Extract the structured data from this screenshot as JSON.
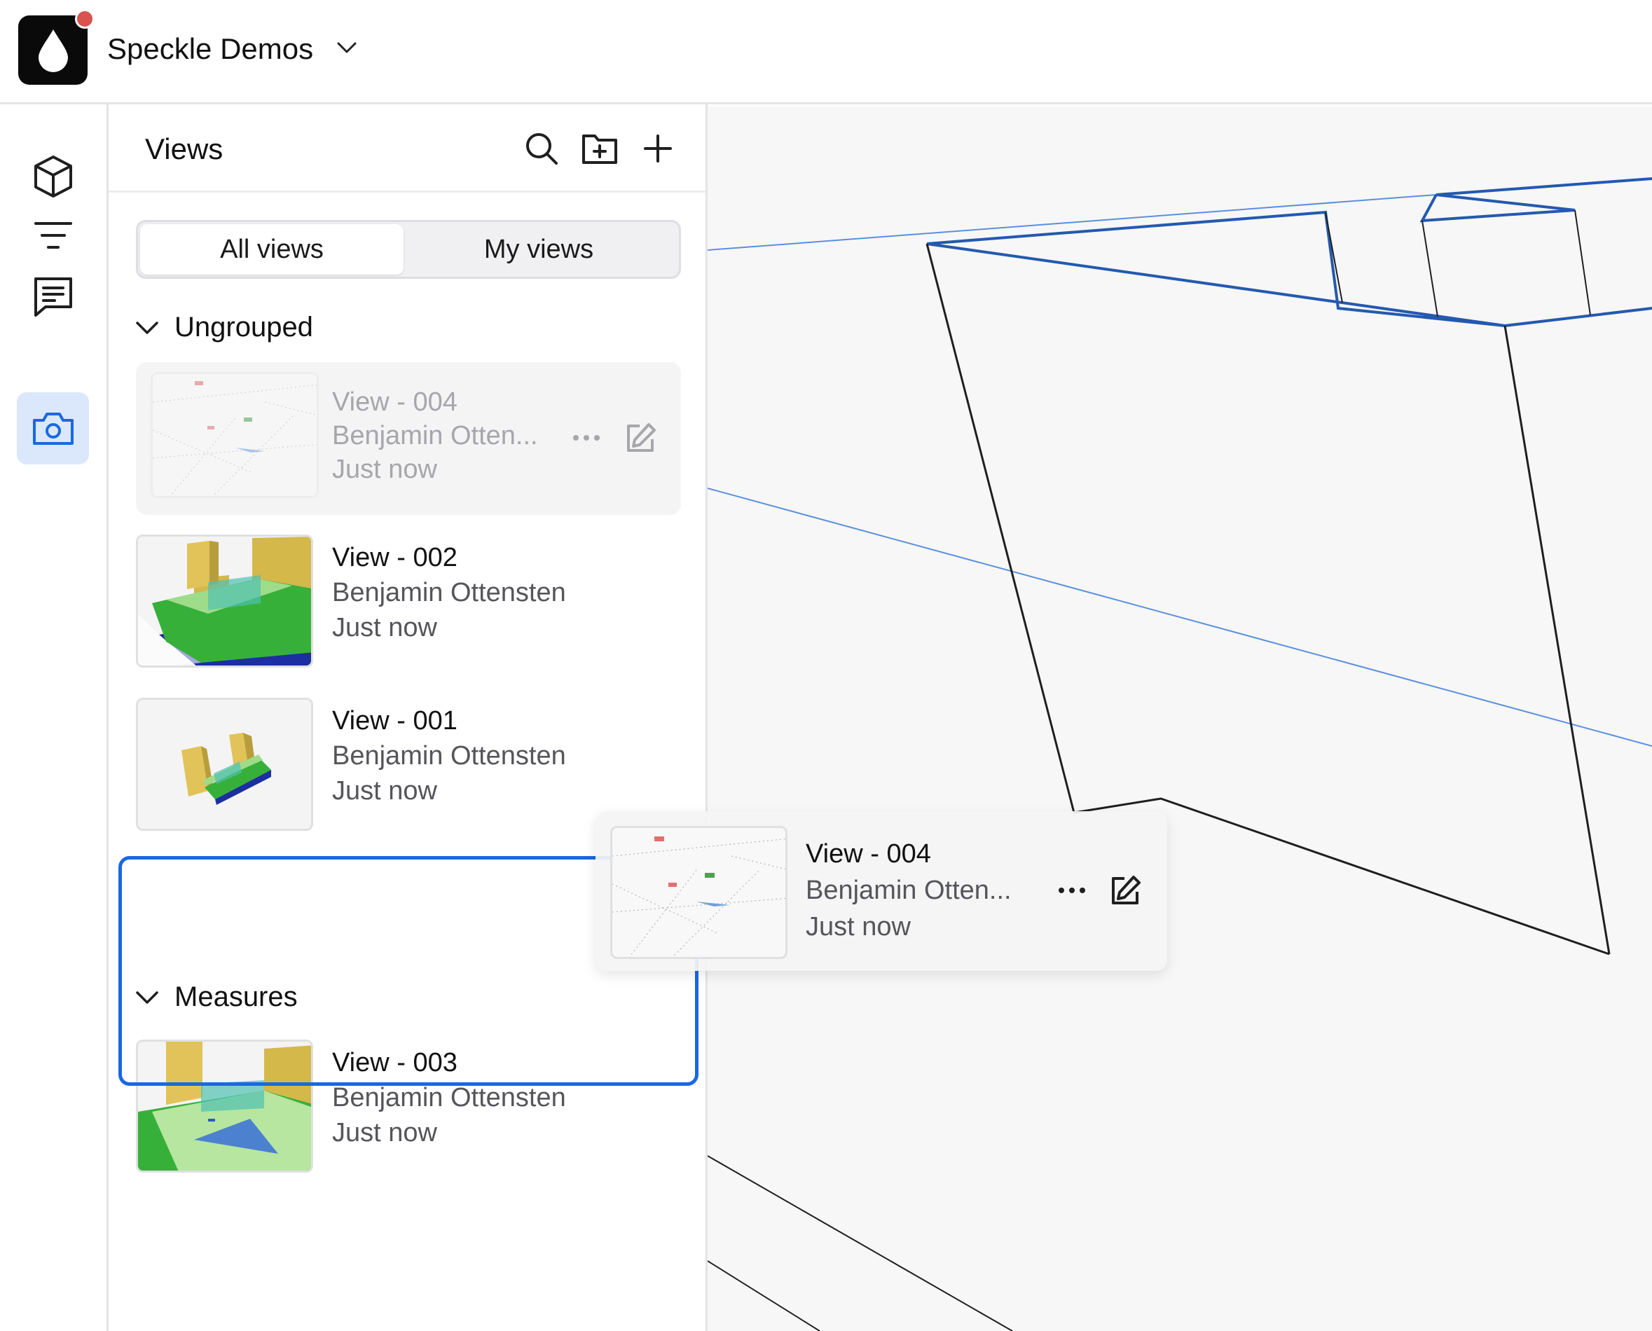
{
  "app": {
    "workspace_name": "Speckle Demos",
    "notification_color": "#d9534f"
  },
  "rail": {
    "items": [
      {
        "icon": "cube-icon",
        "active": false
      },
      {
        "icon": "filter-icon",
        "active": false
      },
      {
        "icon": "comments-icon",
        "active": false
      },
      {
        "icon": "camera-icon",
        "active": true
      }
    ]
  },
  "panel": {
    "title": "Views",
    "actions": [
      "search-icon",
      "folder-plus-icon",
      "plus-icon"
    ],
    "tabs": {
      "all": "All views",
      "mine": "My views",
      "selected": "All views"
    },
    "groups": [
      {
        "name": "Ungrouped",
        "views": [
          {
            "title": "View - 004",
            "author": "Benjamin Otten...",
            "time": "Just now",
            "state": "dragging"
          },
          {
            "title": "View - 002",
            "author": "Benjamin Ottensten",
            "time": "Just now"
          },
          {
            "title": "View - 001",
            "author": "Benjamin Ottensten",
            "time": "Just now"
          }
        ]
      },
      {
        "name": "Measures",
        "views": [
          {
            "title": "View - 003",
            "author": "Benjamin Ottensten",
            "time": "Just now"
          }
        ]
      }
    ]
  },
  "drag_ghost": {
    "title": "View - 004",
    "author": "Benjamin Otten...",
    "time": "Just now"
  },
  "colors": {
    "accent": "#1a68e3",
    "active_bg": "#dbe8fb",
    "wire_blue": "#2459b0",
    "wire_dark": "#1f1f1f"
  }
}
